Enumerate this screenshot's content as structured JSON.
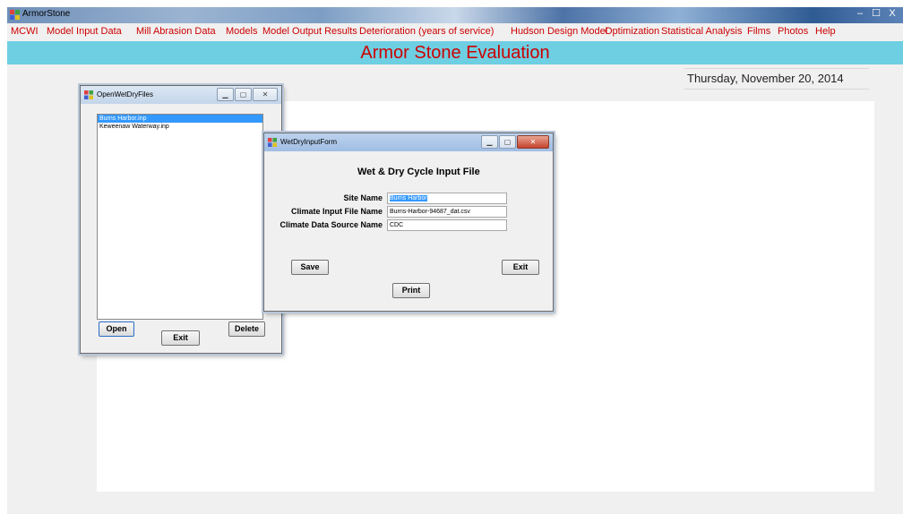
{
  "app": {
    "title": "ArmorStone",
    "controls": {
      "minimize": "–",
      "maximize": "☐",
      "close": "X"
    }
  },
  "menu": [
    {
      "label": "MCWI"
    },
    {
      "label": "Model Input Data"
    },
    {
      "label": "Mill Abrasion Data"
    },
    {
      "label": "Models"
    },
    {
      "label": "Model Output Results"
    },
    {
      "label": "Deterioration (years of service)"
    },
    {
      "label": "Hudson Design Model"
    },
    {
      "label": "Optimization"
    },
    {
      "label": "Statistical Analysis"
    },
    {
      "label": "Films"
    },
    {
      "label": "Photos"
    },
    {
      "label": "Help"
    }
  ],
  "banner": {
    "title": "Armor Stone Evaluation"
  },
  "date": {
    "text": "Thursday, November 20, 2014"
  },
  "open_dialog": {
    "title": "OpenWetDryFiles",
    "files": [
      "Burns Harbor.inp",
      "Keweenaw Waterway.inp"
    ],
    "selected_index": 0,
    "open_label": "Open",
    "exit_label": "Exit",
    "delete_label": "Delete"
  },
  "input_form": {
    "title": "WetDryInputForm",
    "heading": "Wet & Dry Cycle Input File",
    "site_name_label": "Site Name",
    "site_name_value": "Burns Harbor",
    "climate_file_label": "Climate Input File Name",
    "climate_file_value": "Burns-Harbor-94687_dat.csv",
    "climate_source_label": "Climate Data Source Name",
    "climate_source_value": "CDC",
    "save_label": "Save",
    "exit_label": "Exit",
    "print_label": "Print"
  },
  "colors": {
    "menu_text": "#cc0000",
    "banner_bg": "#6ecfe2",
    "selection": "#3399ff"
  }
}
